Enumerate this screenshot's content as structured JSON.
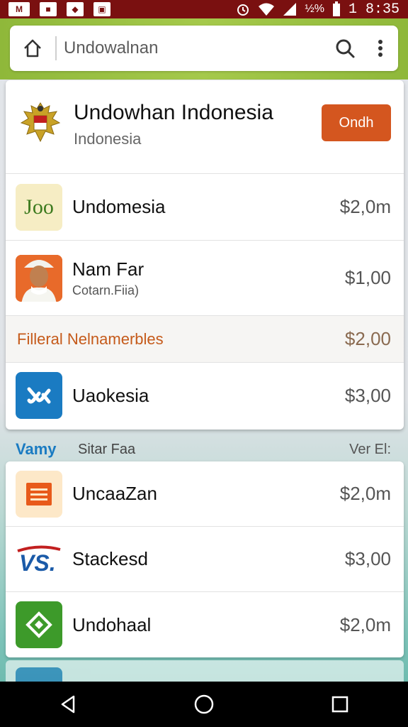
{
  "status_bar": {
    "icons": [
      "mail-icon",
      "camera-icon",
      "shield-icon",
      "image-icon"
    ],
    "icon_labels": [
      "M",
      "■",
      "◆",
      "▣"
    ],
    "battery": "½%",
    "time": "1 8:35"
  },
  "search": {
    "placeholder": "Undowalnan"
  },
  "header": {
    "title": "Undowhan Indonesia",
    "subtitle": "Indonesia",
    "button_label": "Ondh"
  },
  "list_top": [
    {
      "name": "Undomesia",
      "sub": "",
      "price": "$2,0m",
      "icon": "joo-app-icon",
      "icon_text": "Joo",
      "icon_bg": "#f6edc4"
    },
    {
      "name": "Nam Far",
      "sub": "Cotarn.Fiia)",
      "price": "$1,00",
      "icon": "portrait-icon",
      "icon_text": "",
      "icon_bg": "#e86a2a"
    }
  ],
  "filter": {
    "label": "Filleral Nelnamerbles",
    "price": "$2,00"
  },
  "list_mid": [
    {
      "name": "Uaokesia",
      "sub": "",
      "price": "$3,00",
      "icon": "link-app-icon",
      "icon_bg": "#1a7bc2"
    }
  ],
  "section": {
    "brand": "Vamy",
    "title": "Sitar Faa",
    "right": "Ver El:"
  },
  "list_bottom": [
    {
      "name": "UncaaZan",
      "price": "$2,0m",
      "icon": "document-app-icon",
      "icon_bg": "#fde8c8"
    },
    {
      "name": "Stackesd",
      "price": "$3,00",
      "icon": "vs-logo-icon",
      "icon_bg": "#ffffff"
    },
    {
      "name": "Undohaal",
      "price": "$2,0m",
      "icon": "diamond-app-icon",
      "icon_bg": "#3d9a2a"
    }
  ],
  "colors": {
    "status_bar": "#7a1010",
    "top_bar": "#8fb83a",
    "accent_button": "#d4561f",
    "filter_text": "#c55a1a",
    "brand_blue": "#1a7bc2"
  },
  "nav": [
    "back-icon",
    "home-circle-icon",
    "recents-icon"
  ]
}
